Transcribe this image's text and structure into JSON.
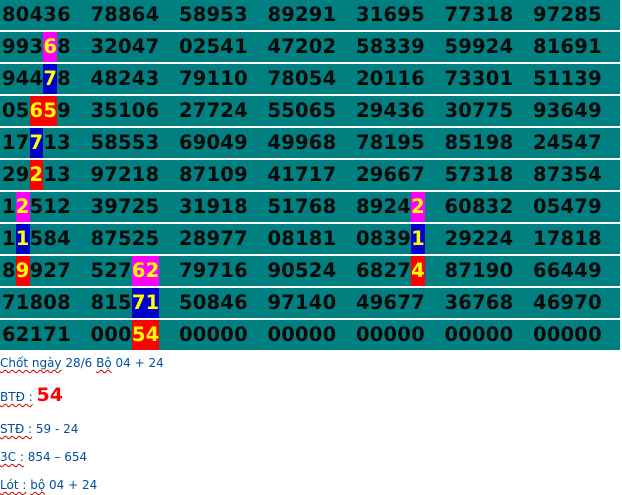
{
  "rows": [
    [
      {
        "t": "80436"
      },
      {
        "t": "78864"
      },
      {
        "t": "58953"
      },
      {
        "t": "89291"
      },
      {
        "t": "31695"
      },
      {
        "t": "77318"
      },
      {
        "t": "97285"
      }
    ],
    [
      {
        "p": "993",
        "h": "6",
        "hc": "pink",
        "s": "8"
      },
      {
        "t": "32047"
      },
      {
        "t": "02541"
      },
      {
        "t": "47202"
      },
      {
        "t": "58339"
      },
      {
        "t": "59924"
      },
      {
        "t": "81691"
      }
    ],
    [
      {
        "p": "944",
        "h": "7",
        "hc": "blue",
        "s": "8"
      },
      {
        "t": "48243"
      },
      {
        "t": "79110"
      },
      {
        "t": "78054"
      },
      {
        "t": "20116"
      },
      {
        "t": "73301"
      },
      {
        "t": "51139"
      }
    ],
    [
      {
        "p": "05",
        "h": "65",
        "hc": "red",
        "s": "9"
      },
      {
        "t": "35106"
      },
      {
        "t": "27724"
      },
      {
        "t": "55065"
      },
      {
        "t": "29436"
      },
      {
        "t": "30775"
      },
      {
        "t": "93649"
      }
    ],
    [
      {
        "p": "17",
        "h": "7",
        "hc": "blue",
        "s": "13"
      },
      {
        "t": "58553"
      },
      {
        "t": "69049"
      },
      {
        "t": "49968"
      },
      {
        "t": "78195"
      },
      {
        "t": "85198"
      },
      {
        "t": "24547"
      }
    ],
    [
      {
        "p": "29",
        "h": "2",
        "hc": "red",
        "s": "13"
      },
      {
        "t": "97218"
      },
      {
        "t": "87109"
      },
      {
        "t": "41717"
      },
      {
        "t": "29667"
      },
      {
        "t": "57318"
      },
      {
        "t": "87354"
      }
    ],
    [
      {
        "p": "1",
        "h": "2",
        "hc": "pink",
        "s": "512"
      },
      {
        "t": "39725"
      },
      {
        "t": "31918"
      },
      {
        "t": "51768"
      },
      {
        "p": "8924",
        "h": "2",
        "hc": "pink",
        "s": ""
      },
      {
        "t": "60832"
      },
      {
        "t": "05479"
      }
    ],
    [
      {
        "p": "1",
        "h": "1",
        "hc": "blue",
        "s": "584"
      },
      {
        "t": "87525"
      },
      {
        "t": "28977"
      },
      {
        "t": "08181"
      },
      {
        "p": "0839",
        "h": "1",
        "hc": "blue",
        "s": ""
      },
      {
        "t": "29224"
      },
      {
        "t": "17818"
      }
    ],
    [
      {
        "p": "8",
        "h": "9",
        "hc": "red",
        "s": "927"
      },
      {
        "p": "527",
        "h": "62",
        "hc": "pink",
        "s": ""
      },
      {
        "t": "79716"
      },
      {
        "t": "90524"
      },
      {
        "p": "6827",
        "h": "4",
        "hc": "red",
        "s": ""
      },
      {
        "t": "87190"
      },
      {
        "t": "66449"
      }
    ],
    [
      {
        "t": "71808"
      },
      {
        "p": "815",
        "h": "71",
        "hc": "blue",
        "s": ""
      },
      {
        "t": "50846"
      },
      {
        "t": "97140"
      },
      {
        "t": "49677"
      },
      {
        "t": "36768"
      },
      {
        "t": "46970"
      }
    ],
    [
      {
        "t": "62171"
      },
      {
        "p": "000",
        "h": "54",
        "hc": "red",
        "s": ""
      },
      {
        "t": "00000"
      },
      {
        "t": "00000"
      },
      {
        "t": "00000"
      },
      {
        "t": "00000"
      },
      {
        "t": "00000"
      }
    ]
  ],
  "notes": {
    "line1": {
      "a": "Chốt ngày",
      "b": " 28/6 ",
      "c": "Bộ",
      "d": " 04  + 24"
    },
    "line2": {
      "a": "BTĐ :",
      "b": "54"
    },
    "line3": {
      "a": "STĐ :",
      "b": " 59 - 24"
    },
    "line4": {
      "a": "3C :",
      "b": " 854 – 654"
    },
    "line5": {
      "a": "Lót :",
      "b": " ",
      "c": "bộ",
      "d": " 04  +  24"
    }
  },
  "colors": {
    "row_bg": "#008080",
    "highlight_red": "#ff0000",
    "highlight_pink": "#ff00ff",
    "highlight_blue": "#0000cc",
    "digit_yellow": "#ffff00"
  }
}
